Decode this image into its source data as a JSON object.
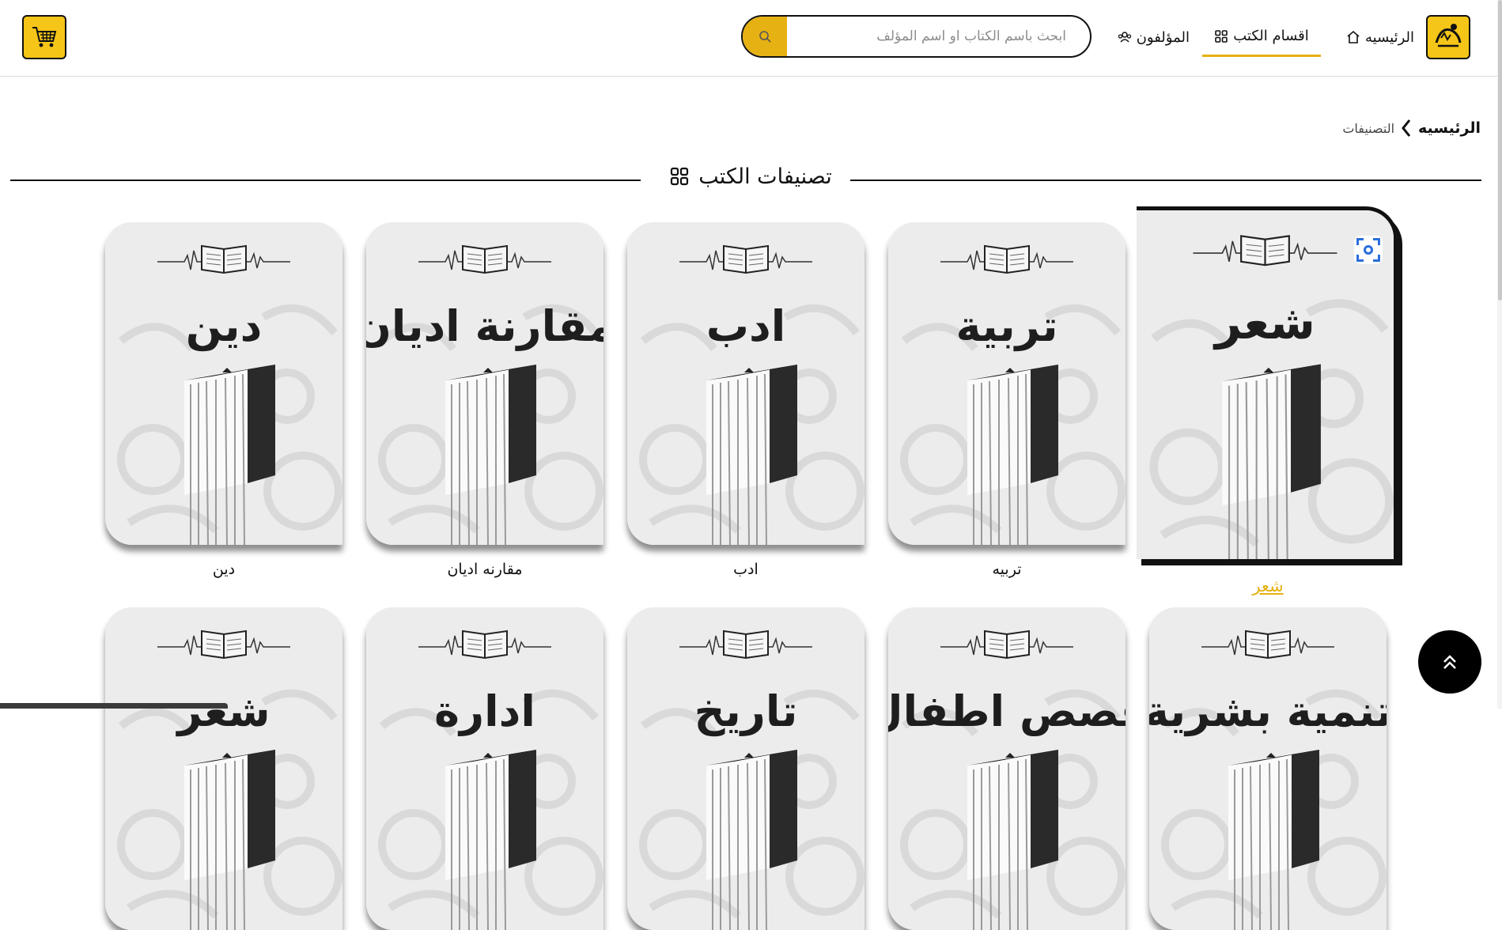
{
  "header": {
    "nav": {
      "home_label": "الرئيسيه",
      "categories_label": "اقسام الكتب",
      "authors_label": "المؤلفون"
    },
    "search": {
      "placeholder": "ابحث باسم الكتاب او اسم المؤلف",
      "value": ""
    },
    "icons": {
      "home": "home-icon",
      "categories": "grid-icon",
      "authors": "users-icon",
      "search": "search-icon",
      "cart": "cart-icon"
    }
  },
  "breadcrumb": {
    "home": "الرئيسيه",
    "current": "التصنيفات"
  },
  "section": {
    "title": "تصنيفات الكتب"
  },
  "categories_row1": [
    {
      "label": "شعر",
      "cover_title": "شعر",
      "active": true
    },
    {
      "label": "تربيه",
      "cover_title": "تربية",
      "active": false
    },
    {
      "label": "ادب",
      "cover_title": "ادب",
      "active": false
    },
    {
      "label": "مقارنه اديان",
      "cover_title": "مقارنة اديان",
      "active": false
    },
    {
      "label": "دين",
      "cover_title": "دين",
      "active": false
    }
  ],
  "categories_row2": [
    {
      "cover_title": "تنمية بشرية"
    },
    {
      "cover_title": "قصص اطفال"
    },
    {
      "cover_title": "تاريخ"
    },
    {
      "cover_title": "ادارة"
    },
    {
      "cover_title": "شعر"
    }
  ],
  "colors": {
    "accent": "#e6b112",
    "brand_yellow": "#f5c518",
    "dark": "#111111"
  }
}
